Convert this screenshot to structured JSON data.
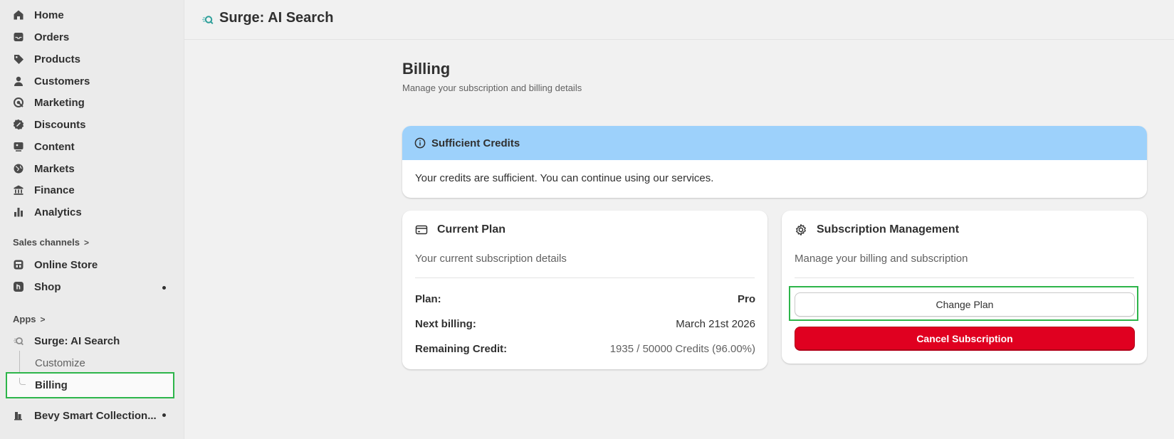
{
  "sidebar": {
    "items": [
      {
        "label": "Home",
        "icon": "home-icon"
      },
      {
        "label": "Orders",
        "icon": "inbox-icon"
      },
      {
        "label": "Products",
        "icon": "tag-icon"
      },
      {
        "label": "Customers",
        "icon": "person-icon"
      },
      {
        "label": "Marketing",
        "icon": "target-icon"
      },
      {
        "label": "Discounts",
        "icon": "discount-icon"
      },
      {
        "label": "Content",
        "icon": "image-icon"
      },
      {
        "label": "Markets",
        "icon": "globe-icon"
      },
      {
        "label": "Finance",
        "icon": "bank-icon"
      },
      {
        "label": "Analytics",
        "icon": "bar-chart-icon"
      }
    ],
    "sales_channels_label": "Sales channels",
    "channels": [
      {
        "label": "Online Store",
        "icon": "store-icon"
      },
      {
        "label": "Shop",
        "icon": "shop-icon"
      }
    ],
    "apps_label": "Apps",
    "apps": {
      "surge": "Surge: AI Search",
      "customize": "Customize",
      "billing": "Billing",
      "bevy": "Bevy Smart Collection..."
    },
    "chevron": ">"
  },
  "topbar": {
    "title": "Surge: AI Search"
  },
  "page": {
    "title": "Billing",
    "subtitle": "Manage your subscription and billing details"
  },
  "banner": {
    "title": "Sufficient Credits",
    "message": "Your credits are sufficient. You can continue using our services.",
    "color": "#9dd1fb"
  },
  "current_plan": {
    "title": "Current Plan",
    "description": "Your current subscription details",
    "rows": [
      {
        "label": "Plan:",
        "value": "Pro"
      },
      {
        "label": "Next billing:",
        "value": "March 21st 2026"
      },
      {
        "label": "Remaining Credit:",
        "value": "1935 / 50000 Credits (96.00%)"
      }
    ]
  },
  "subscription": {
    "title": "Subscription Management",
    "description": "Manage your billing and subscription",
    "change_label": "Change Plan",
    "cancel_label": "Cancel Subscription",
    "danger_color": "#e00020"
  },
  "highlight_color": "#2db54a"
}
